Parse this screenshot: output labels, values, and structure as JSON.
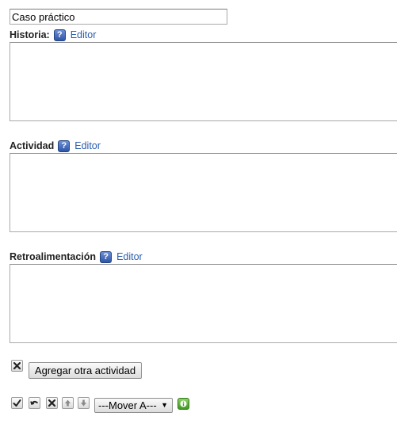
{
  "title_field": {
    "value": "Caso práctico"
  },
  "fields": [
    {
      "label": "Historia:",
      "editor_link": "Editor",
      "value": ""
    },
    {
      "label": "Actividad",
      "editor_link": "Editor",
      "value": ""
    },
    {
      "label": "Retroalimentación",
      "editor_link": "Editor",
      "value": ""
    }
  ],
  "help_icon_text": "?",
  "actions": {
    "add_activity_label": "Agregar otra actividad",
    "move_select_value": "---Mover A---"
  },
  "icons": {
    "delete": "close-x-icon",
    "apply": "checkmark-icon",
    "undo": "undo-arrow-icon",
    "up": "arrow-up-icon",
    "down": "arrow-down-icon",
    "info": "info-icon"
  },
  "colors": {
    "link": "#2a5db0",
    "help_icon": "#2e55a8",
    "info_icon": "#3e9a1f"
  }
}
